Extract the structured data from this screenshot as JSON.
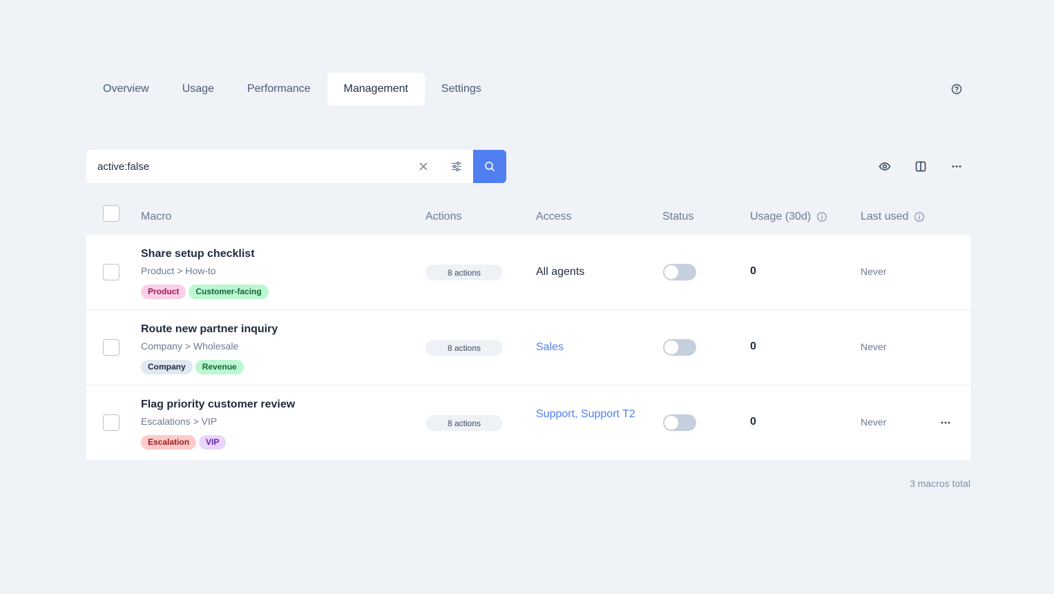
{
  "tabs": [
    {
      "label": "Overview",
      "active": false
    },
    {
      "label": "Usage",
      "active": false
    },
    {
      "label": "Performance",
      "active": false
    },
    {
      "label": "Management",
      "active": true
    },
    {
      "label": "Settings",
      "active": false
    }
  ],
  "icons": {
    "help": "help-circle-icon",
    "clear": "close-icon",
    "filter": "sliders-icon",
    "search": "search-icon",
    "view": "eye-icon",
    "columns": "columns-icon",
    "more": "more-horizontal-icon",
    "info": "info-icon"
  },
  "search": {
    "value": "active:false",
    "placeholder": ""
  },
  "table": {
    "headers": {
      "macro": "Macro",
      "actions": "Actions",
      "access": "Access",
      "status": "Status",
      "usage": "Usage (30d)",
      "last_used": "Last used"
    },
    "rows": [
      {
        "title": "Share setup checklist",
        "path": "Product > How-to",
        "tags": [
          {
            "label": "Product",
            "bg": "#fbcfe8",
            "fg": "#9d174d"
          },
          {
            "label": "Customer-facing",
            "bg": "#bbf7d0",
            "fg": "#166534"
          }
        ],
        "actions": "8 actions",
        "access_plain": "All agents",
        "access_links": [],
        "status_on": false,
        "usage": "0",
        "last_used": "Never",
        "show_more": false
      },
      {
        "title": "Route new partner inquiry",
        "path": "Company > Wholesale",
        "tags": [
          {
            "label": "Company",
            "bg": "#e2e8f0",
            "fg": "#1e293b"
          },
          {
            "label": "Revenue",
            "bg": "#bbf7d0",
            "fg": "#166534"
          }
        ],
        "actions": "8 actions",
        "access_plain": "",
        "access_links": [
          "Sales"
        ],
        "status_on": false,
        "usage": "0",
        "last_used": "Never",
        "show_more": false
      },
      {
        "title": "Flag priority customer review",
        "path": "Escalations > VIP",
        "tags": [
          {
            "label": "Escalation",
            "bg": "#fecaca",
            "fg": "#991b1b"
          },
          {
            "label": "VIP",
            "bg": "#e9d5ff",
            "fg": "#6b21a8"
          }
        ],
        "actions": "8 actions",
        "access_plain": "",
        "access_links": [
          "Support",
          "Support T2"
        ],
        "status_on": false,
        "usage": "0",
        "last_used": "Never",
        "show_more": true
      }
    ]
  },
  "footer": {
    "total": "3 macros total"
  },
  "colors": {
    "accent": "#4f7ff0",
    "background": "#eff2f7"
  }
}
